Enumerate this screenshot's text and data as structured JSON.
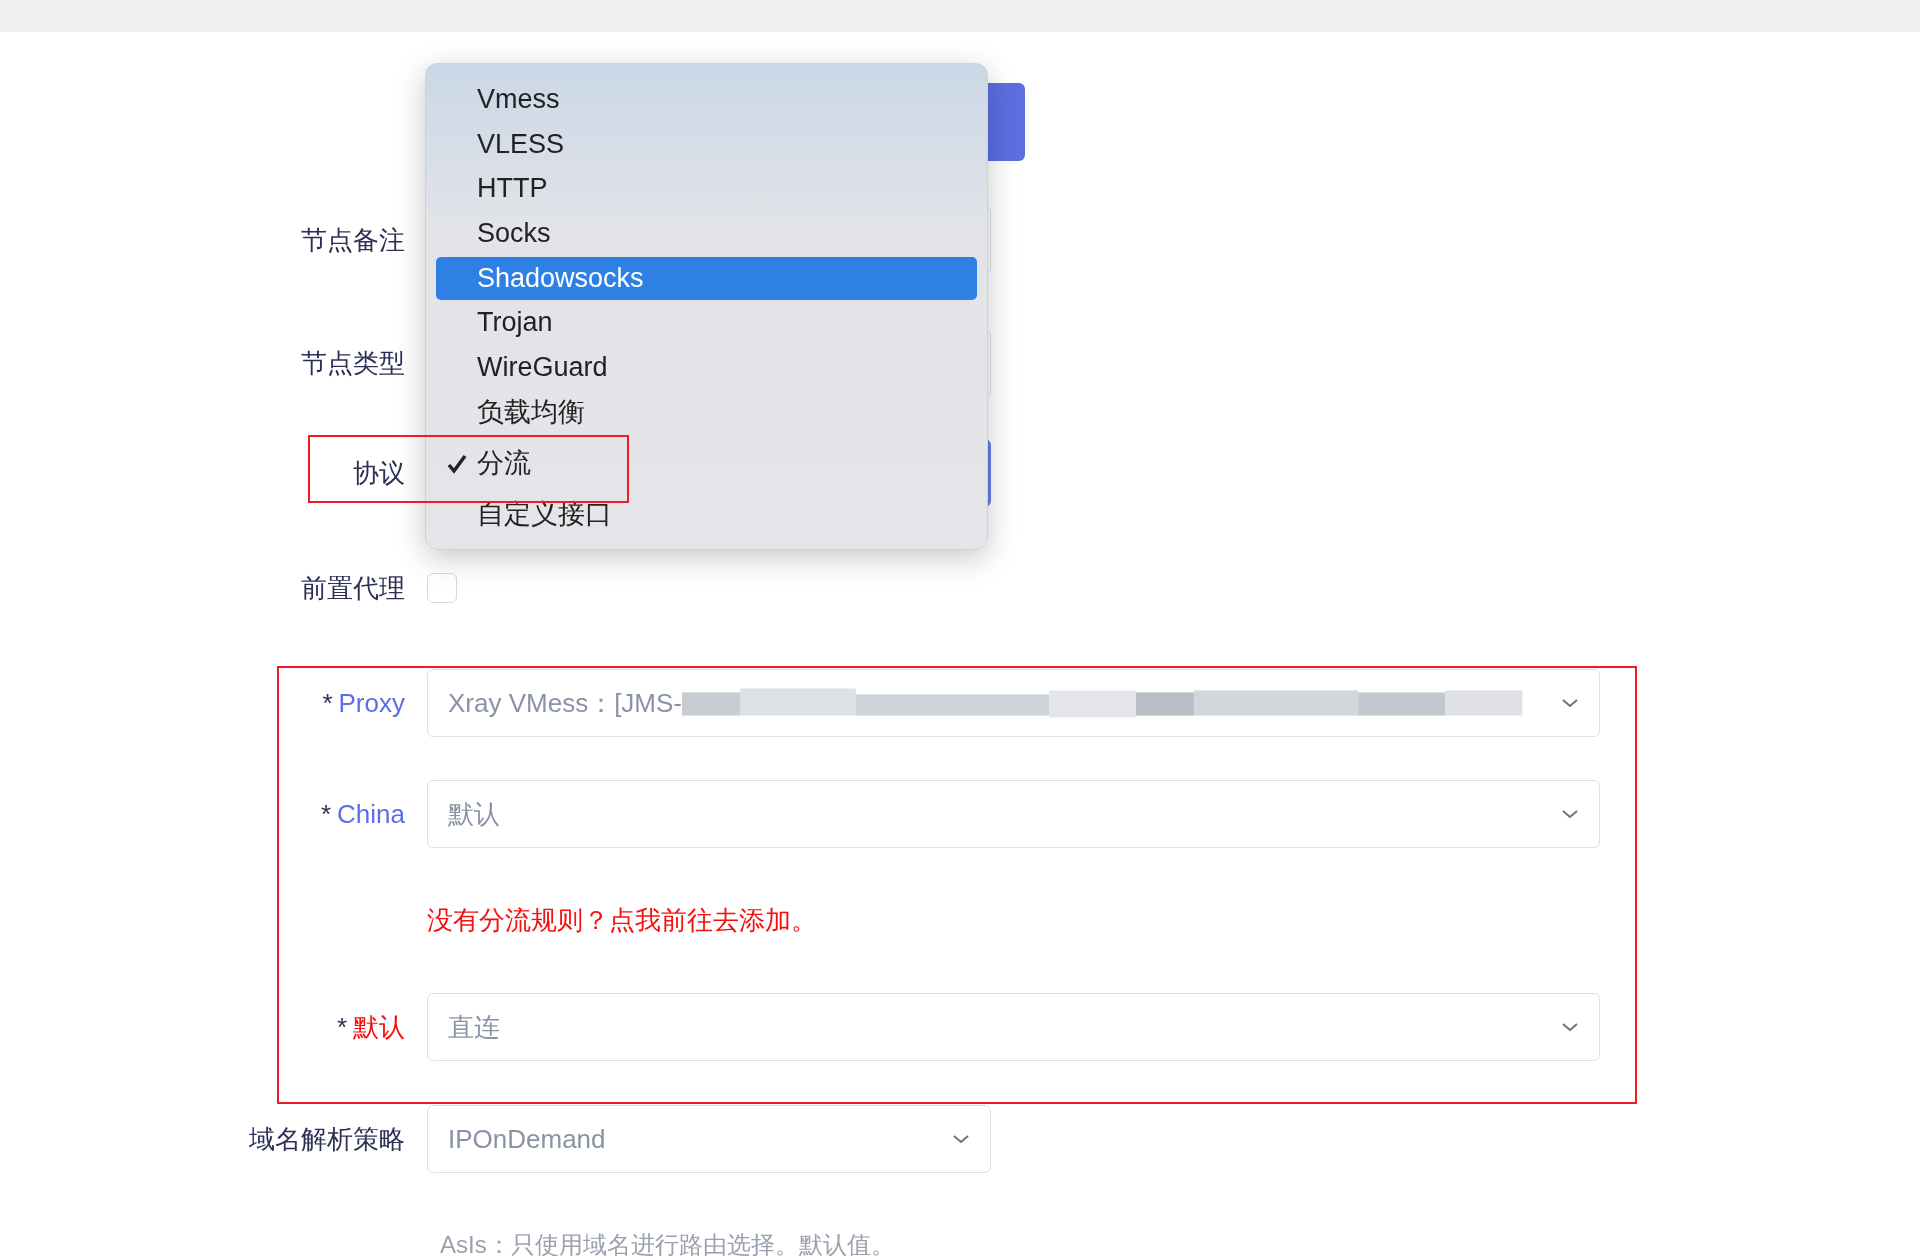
{
  "top_button": {
    "visible": true
  },
  "form": [
    {
      "kind": "select",
      "label": "节点备注"
    },
    {
      "kind": "select",
      "label": "节点类型"
    },
    {
      "kind": "select",
      "label": "协议",
      "focused": true
    },
    {
      "kind": "checkbox",
      "label": "前置代理",
      "checked": false
    },
    {
      "kind": "select",
      "label": "Proxy",
      "mark": "*",
      "color": "#5a6ee8",
      "value": "Xray VMess：[JMS-",
      "redacted": true,
      "wide": true
    },
    {
      "kind": "select",
      "label": "China",
      "mark": "*",
      "color": "#5a6ee8",
      "value": "默认",
      "wide": true
    },
    {
      "kind": "link",
      "text": "没有分流规则？点我前往去添加。"
    },
    {
      "kind": "select",
      "label": "默认",
      "mark": "*",
      "color": "#f50f0f",
      "value": "直连",
      "wide": true
    },
    {
      "kind": "select",
      "label": "域名解析策略",
      "value": "IPOnDemand"
    },
    {
      "kind": "hint",
      "text": "AsIs：只使用域名进行路由选择。默认值。"
    }
  ],
  "menu": {
    "items": [
      {
        "label": "Vmess",
        "selected": false,
        "checked": false
      },
      {
        "label": "VLESS",
        "selected": false,
        "checked": false
      },
      {
        "label": "HTTP",
        "selected": false,
        "checked": false
      },
      {
        "label": "Socks",
        "selected": false,
        "checked": false
      },
      {
        "label": "Shadowsocks",
        "selected": true,
        "checked": false
      },
      {
        "label": "Trojan",
        "selected": false,
        "checked": false
      },
      {
        "label": "WireGuard",
        "selected": false,
        "checked": false
      },
      {
        "label": "负载均衡",
        "selected": false,
        "checked": false
      },
      {
        "label": "分流",
        "selected": false,
        "checked": true
      },
      {
        "label": "自定义接口",
        "selected": false,
        "checked": false
      }
    ]
  }
}
